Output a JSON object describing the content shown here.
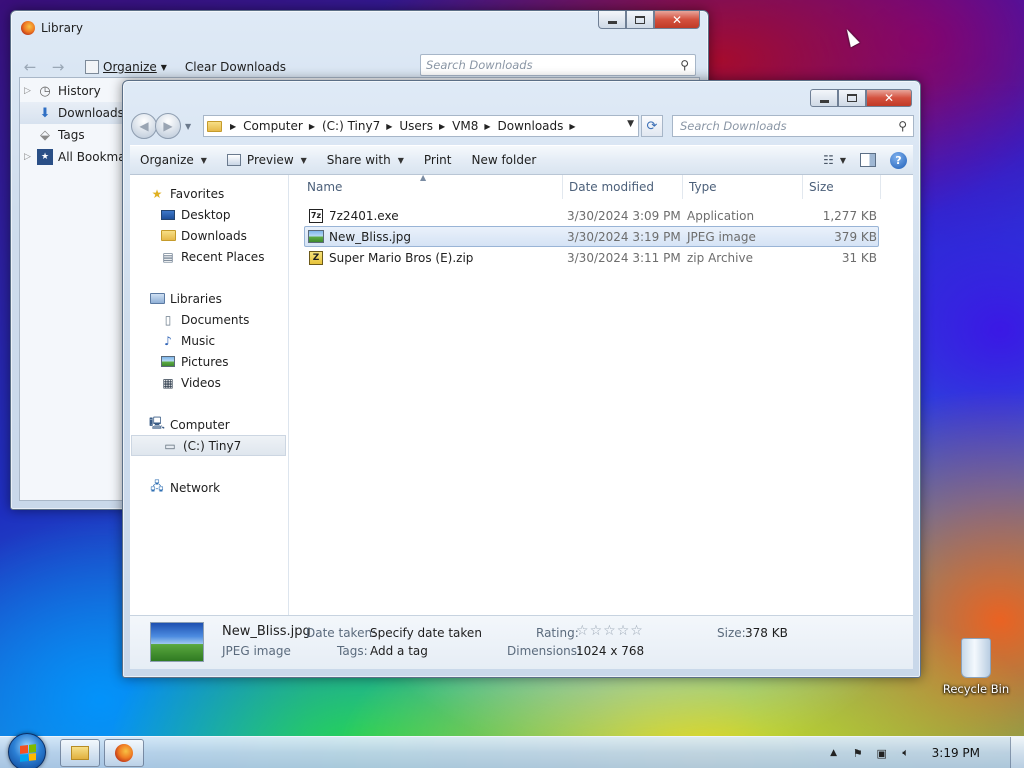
{
  "library": {
    "title": "Library",
    "organize_label": "Organize",
    "clear_label": "Clear Downloads",
    "search_placeholder": "Search Downloads",
    "tree": [
      {
        "label": "History",
        "icon": "clock-icon",
        "twisty": true
      },
      {
        "label": "Downloads",
        "icon": "download-arrow-icon",
        "twisty": false,
        "selected": true
      },
      {
        "label": "Tags",
        "icon": "tag-icon",
        "twisty": false
      },
      {
        "label": "All Bookmarks",
        "icon": "bookmark-icon",
        "twisty": true
      }
    ]
  },
  "explorer": {
    "breadcrumb": [
      "Computer",
      "(C:) Tiny7",
      "Users",
      "VM8",
      "Downloads"
    ],
    "search_placeholder": "Search Downloads",
    "commands": {
      "organize": "Organize",
      "preview": "Preview",
      "share_with": "Share with",
      "print": "Print",
      "new_folder": "New folder"
    },
    "nav": {
      "favorites": "Favorites",
      "desktop": "Desktop",
      "downloads": "Downloads",
      "recent_places": "Recent Places",
      "libraries": "Libraries",
      "documents": "Documents",
      "music": "Music",
      "pictures": "Pictures",
      "videos": "Videos",
      "computer": "Computer",
      "drive_c": "(C:) Tiny7",
      "network": "Network"
    },
    "columns": {
      "name": "Name",
      "date": "Date modified",
      "type": "Type",
      "size": "Size"
    },
    "files": [
      {
        "name": "7z2401.exe",
        "date": "3/30/2024 3:09 PM",
        "type": "Application",
        "size": "1,277 KB",
        "icon": "exe-icon",
        "selected": false
      },
      {
        "name": "New_Bliss.jpg",
        "date": "3/30/2024 3:19 PM",
        "type": "JPEG image",
        "size": "379 KB",
        "icon": "jpg-icon",
        "selected": true
      },
      {
        "name": "Super Mario Bros (E).zip",
        "date": "3/30/2024 3:11 PM",
        "type": "zip Archive",
        "size": "31 KB",
        "icon": "zip-icon",
        "selected": false
      }
    ],
    "details": {
      "filename": "New_Bliss.jpg",
      "filetype": "JPEG image",
      "date_taken_label": "Date taken:",
      "date_taken_value": "Specify date taken",
      "tags_label": "Tags:",
      "tags_value": "Add a tag",
      "rating_label": "Rating:",
      "rating_stars": 0,
      "dimensions_label": "Dimensions:",
      "dimensions_value": "1024 x 768",
      "size_label": "Size:",
      "size_value": "378 KB"
    }
  },
  "desktop": {
    "recycle_bin_label": "Recycle Bin"
  },
  "taskbar": {
    "clock": "3:19 PM"
  }
}
